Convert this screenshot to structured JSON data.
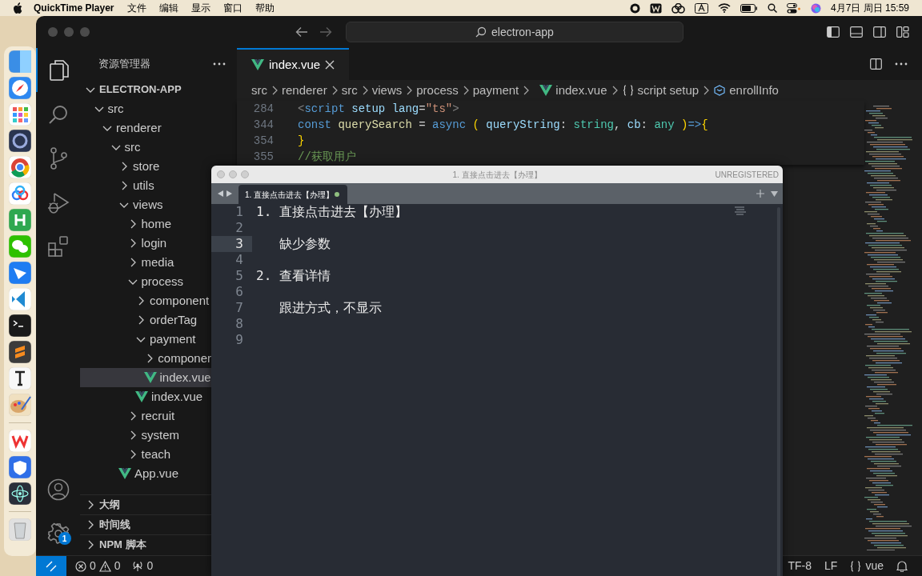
{
  "menu_bar": {
    "app_name": "QuickTime Player",
    "menus": [
      "文件",
      "编辑",
      "显示",
      "窗口",
      "帮助"
    ],
    "clock": "4月7日 周日 15:59"
  },
  "vscode": {
    "command_center": "electron-app",
    "settings_badge": "1",
    "sidebar": {
      "title": "资源管理器",
      "tree": [
        {
          "label": "ELECTRON-APP",
          "kind": "root",
          "expanded": true,
          "selected": false,
          "children": [
            {
              "label": "src",
              "kind": "folder",
              "expanded": true,
              "selected": false,
              "children": [
                {
                  "label": "renderer",
                  "kind": "folder",
                  "expanded": true,
                  "selected": false,
                  "children": [
                    {
                      "label": "src",
                      "kind": "folder",
                      "expanded": true,
                      "selected": false,
                      "children": [
                        {
                          "label": "store",
                          "kind": "folder",
                          "expanded": false,
                          "selected": false
                        },
                        {
                          "label": "utils",
                          "kind": "folder",
                          "expanded": false,
                          "selected": false
                        },
                        {
                          "label": "views",
                          "kind": "folder",
                          "expanded": true,
                          "selected": false,
                          "children": [
                            {
                              "label": "home",
                              "kind": "folder",
                              "expanded": false,
                              "selected": false
                            },
                            {
                              "label": "login",
                              "kind": "folder",
                              "expanded": false,
                              "selected": false
                            },
                            {
                              "label": "media",
                              "kind": "folder",
                              "expanded": false,
                              "selected": false
                            },
                            {
                              "label": "process",
                              "kind": "folder",
                              "expanded": true,
                              "selected": false,
                              "children": [
                                {
                                  "label": "component",
                                  "kind": "folder",
                                  "expanded": false,
                                  "selected": false
                                },
                                {
                                  "label": "orderTag",
                                  "kind": "folder",
                                  "expanded": false,
                                  "selected": false
                                },
                                {
                                  "label": "payment",
                                  "kind": "folder",
                                  "expanded": true,
                                  "selected": false,
                                  "children": [
                                    {
                                      "label": "componer",
                                      "kind": "folder",
                                      "expanded": false,
                                      "selected": false
                                    },
                                    {
                                      "label": "index.vue",
                                      "kind": "file",
                                      "selected": true
                                    }
                                  ]
                                },
                                {
                                  "label": "index.vue",
                                  "kind": "file",
                                  "selected": false
                                }
                              ]
                            },
                            {
                              "label": "recruit",
                              "kind": "folder",
                              "expanded": false,
                              "selected": false
                            },
                            {
                              "label": "system",
                              "kind": "folder",
                              "expanded": false,
                              "selected": false
                            },
                            {
                              "label": "teach",
                              "kind": "folder",
                              "expanded": false,
                              "selected": false
                            }
                          ]
                        },
                        {
                          "label": "App.vue",
                          "kind": "file",
                          "selected": false
                        }
                      ]
                    }
                  ]
                }
              ]
            }
          ]
        }
      ],
      "panels": [
        {
          "label": "大纲",
          "expanded": false
        },
        {
          "label": "时间线",
          "expanded": false
        },
        {
          "label": "NPM 脚本",
          "expanded": false
        }
      ]
    },
    "tabs": [
      {
        "label": "index.vue",
        "selected": true
      }
    ],
    "breadcrumbs": [
      {
        "kind": "folder",
        "label": "src"
      },
      {
        "kind": "folder",
        "label": "renderer"
      },
      {
        "kind": "folder",
        "label": "src"
      },
      {
        "kind": "folder",
        "label": "views"
      },
      {
        "kind": "folder",
        "label": "process"
      },
      {
        "kind": "folder",
        "label": "payment"
      },
      {
        "kind": "vue",
        "label": "index.vue"
      },
      {
        "kind": "section",
        "label": "script setup"
      },
      {
        "kind": "symbol",
        "label": "enrollInfo"
      }
    ],
    "code_lines": [
      {
        "number": "284",
        "tokens": [
          {
            "kind": "punct",
            "text": "<"
          },
          {
            "kind": "tag",
            "text": "script"
          },
          {
            "kind": "attr",
            "text": " setup lang"
          },
          {
            "kind": "plain",
            "text": "="
          },
          {
            "kind": "string",
            "text": "\"ts\""
          },
          {
            "kind": "punct",
            "text": ">"
          }
        ]
      },
      {
        "number": "344",
        "tokens": [
          {
            "kind": "keyword",
            "text": "const "
          },
          {
            "kind": "func",
            "text": "querySearch"
          },
          {
            "kind": "plain",
            "text": " = "
          },
          {
            "kind": "keyword",
            "text": "async "
          },
          {
            "kind": "bracket",
            "text": "( "
          },
          {
            "kind": "param",
            "text": "queryString"
          },
          {
            "kind": "plain",
            "text": ": "
          },
          {
            "kind": "type",
            "text": "string"
          },
          {
            "kind": "plain",
            "text": ", "
          },
          {
            "kind": "param",
            "text": "cb"
          },
          {
            "kind": "plain",
            "text": ": "
          },
          {
            "kind": "type",
            "text": "any"
          },
          {
            "kind": "bracket",
            "text": " )"
          },
          {
            "kind": "keyword",
            "text": "=>"
          },
          {
            "kind": "bracket",
            "text": "{"
          }
        ]
      },
      {
        "number": "354",
        "tokens": [
          {
            "kind": "bracket",
            "text": "}"
          }
        ]
      },
      {
        "number": "355",
        "tokens": [
          {
            "kind": "comment",
            "text": "//获取用户"
          }
        ]
      }
    ],
    "status_bar": {
      "errors": "0",
      "warnings": "0",
      "ports": "0",
      "encoding": "TF-8",
      "line_ending": "LF",
      "language": "vue"
    }
  },
  "sublime": {
    "title": "1. 直接点击进去【办理】",
    "registration": "UNREGISTERED",
    "tabs": [
      {
        "label": "1. 直接点击进去【办理】",
        "selected": true,
        "modified": true
      }
    ],
    "lines": [
      {
        "number": "1",
        "text": "1. 直接点击进去【办理】",
        "selected": false
      },
      {
        "number": "2",
        "selected": false
      },
      {
        "number": "3",
        "text": "   缺少参数",
        "selected": true
      },
      {
        "number": "4",
        "selected": false
      },
      {
        "number": "5",
        "text": "2. 查看详情",
        "selected": false
      },
      {
        "number": "6",
        "selected": false
      },
      {
        "number": "7",
        "text": "   跟进方式，不显示",
        "selected": false
      },
      {
        "number": "8",
        "selected": false
      },
      {
        "number": "9",
        "selected": false
      }
    ]
  }
}
